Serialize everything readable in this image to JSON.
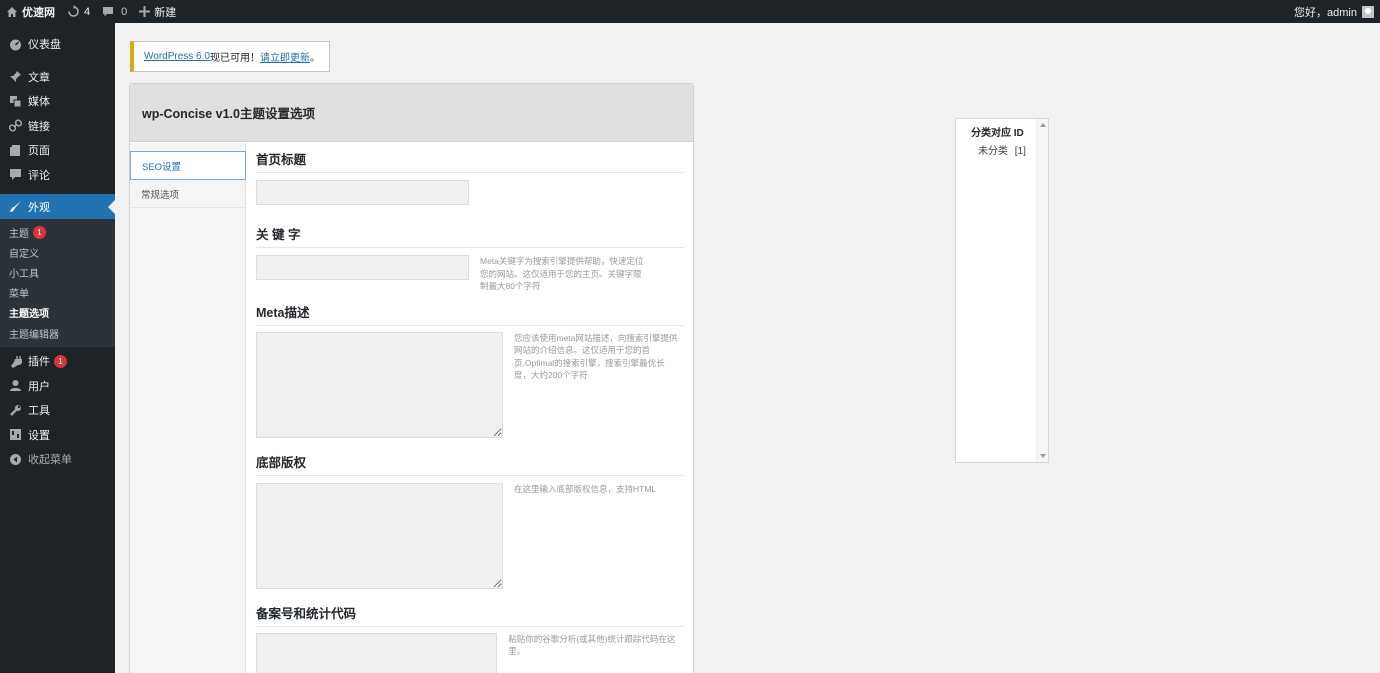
{
  "adminbar": {
    "site_name": "优速网",
    "updates_count": "4",
    "comments_count": "0",
    "new_label": "新建",
    "greeting": "您好，admin"
  },
  "sidebar": {
    "dashboard": "仪表盘",
    "posts": "文章",
    "media": "媒体",
    "links": "链接",
    "pages": "页面",
    "comments": "评论",
    "appearance": "外观",
    "submenu": {
      "themes": "主题",
      "themes_badge": "1",
      "customize": "自定义",
      "widgets": "小工具",
      "menus": "菜单",
      "theme_options": "主题选项",
      "theme_editor": "主题编辑器"
    },
    "plugins": "插件",
    "plugins_badge": "1",
    "users": "用户",
    "tools": "工具",
    "settings": "设置",
    "collapse": "收起菜单"
  },
  "notice": {
    "version_link": "WordPress 6.0",
    "middle_text": "现已可用！",
    "update_link": "请立即更新",
    "end_text": "。"
  },
  "panel": {
    "title": "wp-Concise v1.0主题设置选项",
    "tabs": [
      "SEO设置",
      "常规选项"
    ],
    "sections": {
      "home_title": {
        "label": "首页标题",
        "value": ""
      },
      "keywords": {
        "label": "关 键 字",
        "value": "",
        "desc": "Meta关键字为搜索引擎提供帮助，快速定位您的网站。这仅适用于您的主页。关键字限制最大80个字符"
      },
      "meta_desc": {
        "label": "Meta描述",
        "value": "",
        "desc": "您应该使用meta网站描述，向搜索引擎提供网站的介绍信息。这仅适用于您的首页,Optimal的搜索引擎，搜索引擎最优长度，大约200个字符"
      },
      "copyright": {
        "label": "底部版权",
        "value": "",
        "desc": "在这里输入底部版权信息，支持HTML"
      },
      "icp_stats": {
        "label": "备案号和统计代码",
        "value": "",
        "desc": "粘贴你的谷歌分析(或其他)统计跟踪代码在这里。"
      }
    }
  },
  "category_box": {
    "title": "分类对应 ID",
    "items": [
      {
        "name": "未分类",
        "id": "[1]"
      }
    ]
  }
}
